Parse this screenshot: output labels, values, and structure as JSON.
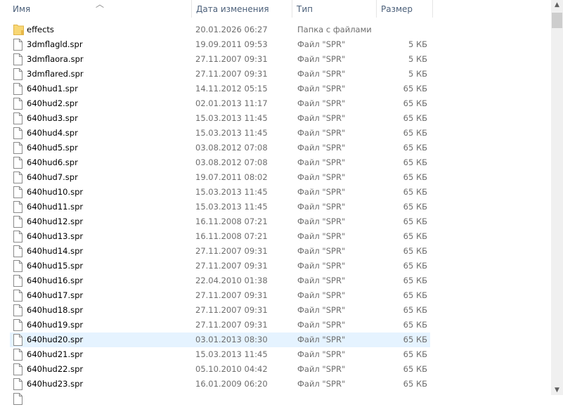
{
  "columns": {
    "name": "Имя",
    "date": "Дата изменения",
    "type": "Тип",
    "size": "Размер"
  },
  "files": [
    {
      "name": "effects",
      "date": "20.01.2026 06:27",
      "type": "Папка с файлами",
      "size": "",
      "icon": "folder-icon"
    },
    {
      "name": "3dmflagld.spr",
      "date": "19.09.2011 09:53",
      "type": "Файл \"SPR\"",
      "size": "5 КБ",
      "icon": "file-icon"
    },
    {
      "name": "3dmflaora.spr",
      "date": "27.11.2007 09:31",
      "type": "Файл \"SPR\"",
      "size": "5 КБ",
      "icon": "file-icon"
    },
    {
      "name": "3dmflared.spr",
      "date": "27.11.2007 09:31",
      "type": "Файл \"SPR\"",
      "size": "5 КБ",
      "icon": "file-icon"
    },
    {
      "name": "640hud1.spr",
      "date": "14.11.2012 05:15",
      "type": "Файл \"SPR\"",
      "size": "65 КБ",
      "icon": "file-icon"
    },
    {
      "name": "640hud2.spr",
      "date": "02.01.2013 11:17",
      "type": "Файл \"SPR\"",
      "size": "65 КБ",
      "icon": "file-icon"
    },
    {
      "name": "640hud3.spr",
      "date": "15.03.2013 11:45",
      "type": "Файл \"SPR\"",
      "size": "65 КБ",
      "icon": "file-icon"
    },
    {
      "name": "640hud4.spr",
      "date": "15.03.2013 11:45",
      "type": "Файл \"SPR\"",
      "size": "65 КБ",
      "icon": "file-icon"
    },
    {
      "name": "640hud5.spr",
      "date": "03.08.2012 07:08",
      "type": "Файл \"SPR\"",
      "size": "65 КБ",
      "icon": "file-icon"
    },
    {
      "name": "640hud6.spr",
      "date": "03.08.2012 07:08",
      "type": "Файл \"SPR\"",
      "size": "65 КБ",
      "icon": "file-icon"
    },
    {
      "name": "640hud7.spr",
      "date": "19.07.2011 08:02",
      "type": "Файл \"SPR\"",
      "size": "65 КБ",
      "icon": "file-icon"
    },
    {
      "name": "640hud10.spr",
      "date": "15.03.2013 11:45",
      "type": "Файл \"SPR\"",
      "size": "65 КБ",
      "icon": "file-icon"
    },
    {
      "name": "640hud11.spr",
      "date": "15.03.2013 11:45",
      "type": "Файл \"SPR\"",
      "size": "65 КБ",
      "icon": "file-icon"
    },
    {
      "name": "640hud12.spr",
      "date": "16.11.2008 07:21",
      "type": "Файл \"SPR\"",
      "size": "65 КБ",
      "icon": "file-icon"
    },
    {
      "name": "640hud13.spr",
      "date": "16.11.2008 07:21",
      "type": "Файл \"SPR\"",
      "size": "65 КБ",
      "icon": "file-icon"
    },
    {
      "name": "640hud14.spr",
      "date": "27.11.2007 09:31",
      "type": "Файл \"SPR\"",
      "size": "65 КБ",
      "icon": "file-icon"
    },
    {
      "name": "640hud15.spr",
      "date": "27.11.2007 09:31",
      "type": "Файл \"SPR\"",
      "size": "65 КБ",
      "icon": "file-icon"
    },
    {
      "name": "640hud16.spr",
      "date": "22.04.2010 01:38",
      "type": "Файл \"SPR\"",
      "size": "65 КБ",
      "icon": "file-icon"
    },
    {
      "name": "640hud17.spr",
      "date": "27.11.2007 09:31",
      "type": "Файл \"SPR\"",
      "size": "65 КБ",
      "icon": "file-icon"
    },
    {
      "name": "640hud18.spr",
      "date": "27.11.2007 09:31",
      "type": "Файл \"SPR\"",
      "size": "65 КБ",
      "icon": "file-icon"
    },
    {
      "name": "640hud19.spr",
      "date": "27.11.2007 09:31",
      "type": "Файл \"SPR\"",
      "size": "65 КБ",
      "icon": "file-icon"
    },
    {
      "name": "640hud20.spr",
      "date": "03.01.2013 08:30",
      "type": "Файл \"SPR\"",
      "size": "65 КБ",
      "icon": "file-icon",
      "hover": true
    },
    {
      "name": "640hud21.spr",
      "date": "15.03.2013 11:45",
      "type": "Файл \"SPR\"",
      "size": "65 КБ",
      "icon": "file-icon"
    },
    {
      "name": "640hud22.spr",
      "date": "05.10.2010 04:42",
      "type": "Файл \"SPR\"",
      "size": "65 КБ",
      "icon": "file-icon"
    },
    {
      "name": "640hud23.spr",
      "date": "16.01.2009 06:20",
      "type": "Файл \"SPR\"",
      "size": "65 КБ",
      "icon": "file-icon"
    }
  ]
}
